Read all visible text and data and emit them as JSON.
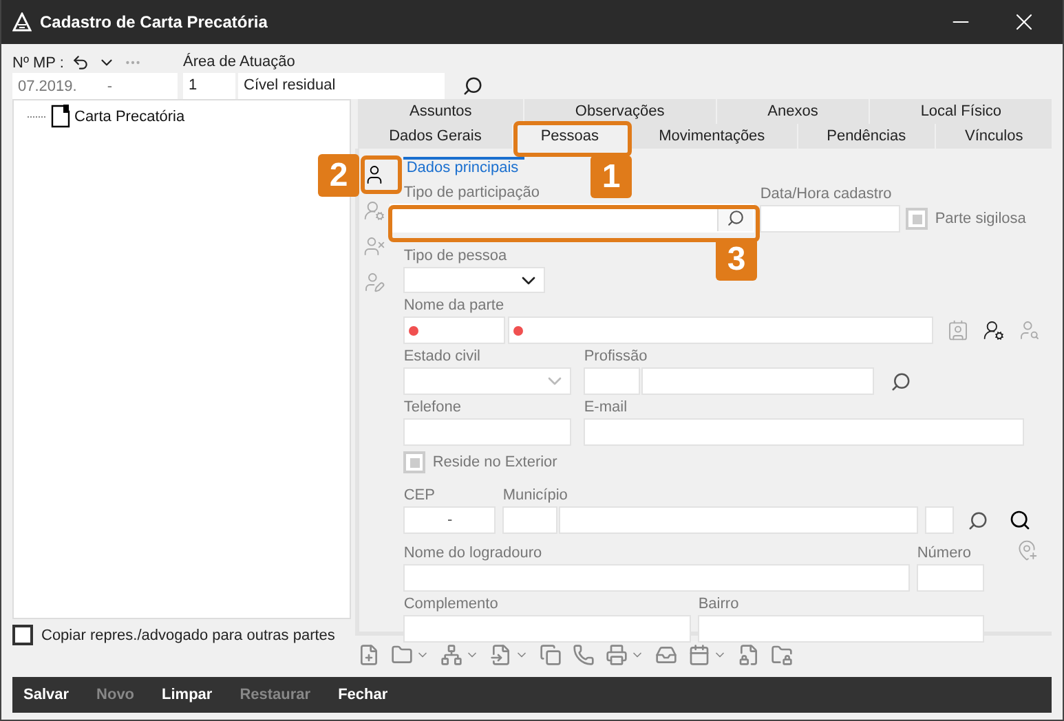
{
  "window": {
    "title": "Cadastro de Carta Precatória"
  },
  "header": {
    "mp_label": "Nº MP :",
    "mp_year": "07.2019.",
    "mp_dash": "-",
    "area_label": "Área de Atuação",
    "area_code": "1",
    "area_name": "Cível residual"
  },
  "tree": [
    {
      "label": "Carta Precatória"
    }
  ],
  "copy_option": {
    "label": "Copiar repres./advogado para outras partes",
    "checked": false
  },
  "tab_rows": [
    [
      {
        "label": "Assuntos",
        "selected": false
      },
      {
        "label": "Observações",
        "selected": false
      },
      {
        "label": "Anexos",
        "selected": false
      },
      {
        "label": "Local Físico",
        "selected": false
      }
    ],
    [
      {
        "label": "Dados Gerais",
        "selected": false
      },
      {
        "label": "Pessoas",
        "selected": true
      },
      {
        "label": "Movimentações",
        "selected": false
      },
      {
        "label": "Pendências",
        "selected": false
      },
      {
        "label": "Vínculos",
        "selected": false
      }
    ]
  ],
  "subnav": {
    "label": "Dados principais"
  },
  "side_tools": [
    {
      "kind": "person",
      "selected": true
    },
    {
      "kind": "person-info",
      "selected": false
    },
    {
      "kind": "person-remove",
      "selected": false
    },
    {
      "kind": "person-edit",
      "selected": false
    }
  ],
  "form": {
    "participation": {
      "label": "Tipo de participação"
    },
    "registered": {
      "label": "Data/Hora cadastro"
    },
    "secret": {
      "label": "Parte sigilosa",
      "checked": false,
      "disabled": true
    },
    "person_type": {
      "label": "Tipo de pessoa"
    },
    "party_name": {
      "label": "Nome da parte"
    },
    "party_tools": [
      {
        "kind": "person-card",
        "disabled": true
      },
      {
        "kind": "person-swap",
        "disabled": false
      },
      {
        "kind": "person-search",
        "disabled": true
      }
    ],
    "civil_state": {
      "label": "Estado civil",
      "disabled": true
    },
    "profession": {
      "label": "Profissão"
    },
    "phone": {
      "label": "Telefone"
    },
    "email": {
      "label": "E-mail"
    },
    "abroad": {
      "label": "Reside no Exterior",
      "checked": false,
      "disabled": true
    },
    "zip": {
      "label": "CEP",
      "value": "-"
    },
    "city": {
      "label": "Município"
    },
    "street": {
      "label": "Nome do logradouro"
    },
    "number": {
      "label": "Número"
    },
    "complement": {
      "label": "Complemento"
    },
    "district": {
      "label": "Bairro"
    }
  },
  "callouts": [
    {
      "label": "1"
    },
    {
      "label": "2"
    },
    {
      "label": "3"
    }
  ],
  "actions": [
    {
      "label": "Salvar",
      "disabled": false
    },
    {
      "label": "Novo",
      "disabled": true
    },
    {
      "label": "Limpar",
      "disabled": false
    },
    {
      "label": "Restaurar",
      "disabled": true
    },
    {
      "label": "Fechar",
      "disabled": false
    }
  ]
}
